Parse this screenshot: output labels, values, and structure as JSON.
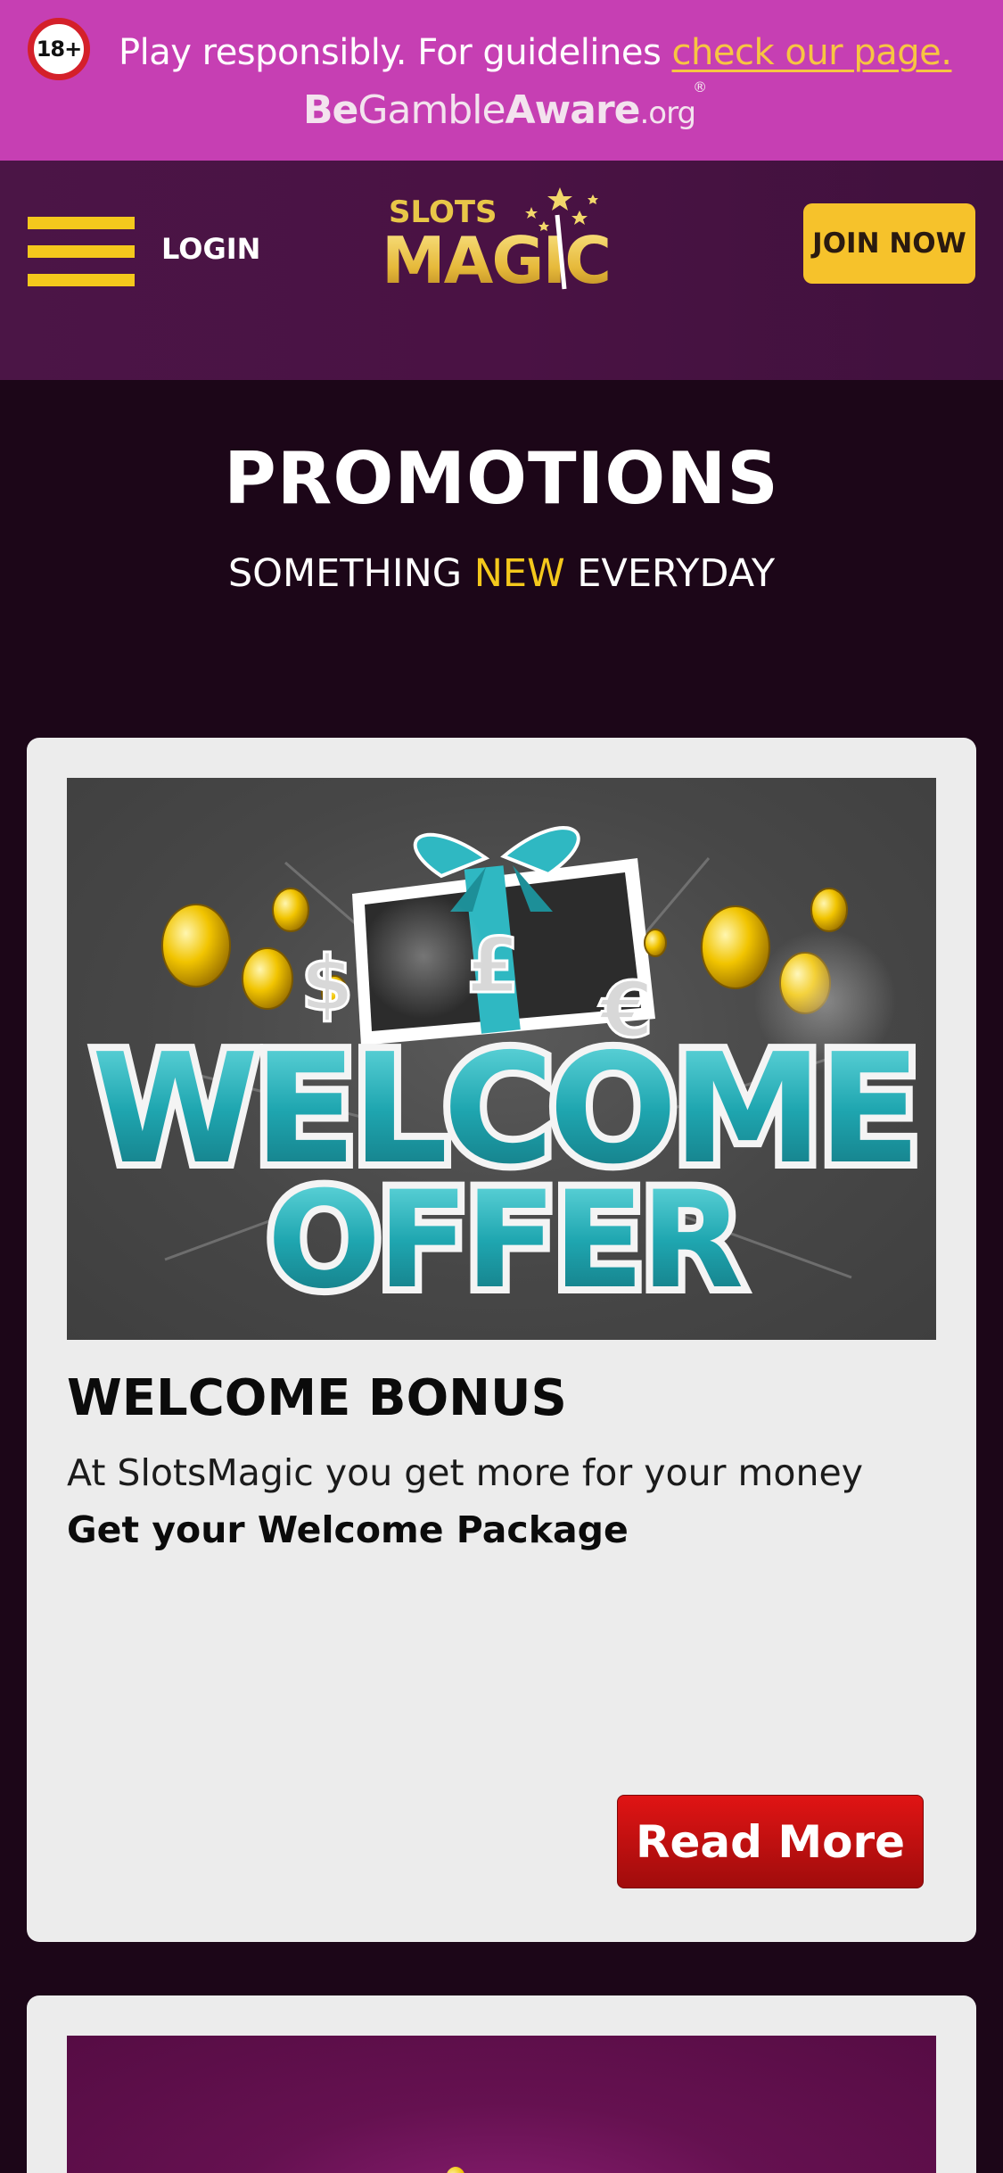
{
  "banner": {
    "age_badge": "18+",
    "text": "Play responsibly. For guidelines ",
    "link_text": "check our page.",
    "logo_be": "Be",
    "logo_gamble": "Gamble",
    "logo_aware": "Aware",
    "logo_org": ".org",
    "logo_reg": "®"
  },
  "header": {
    "menu_icon": "hamburger-menu-icon",
    "login_label": "LOGIN",
    "logo_top": "SLOTS",
    "logo_bottom": "MAGIC",
    "join_label": "JOIN NOW"
  },
  "promotions": {
    "title": "PROMOTIONS",
    "subtitle_before": "SOMETHING ",
    "subtitle_highlight": "NEW",
    "subtitle_after": " EVERYDAY"
  },
  "cards": [
    {
      "image_text_line1": "WELCOME",
      "image_text_line2": "OFFER",
      "currency_symbols": [
        "$",
        "£",
        "€"
      ],
      "title": "WELCOME BONUS",
      "description": "At SlotsMagic you get more for your money",
      "cta_text": "Get your Welcome Package",
      "button_label": "Read More"
    }
  ],
  "colors": {
    "banner_bg": "#c63fb3",
    "header_bg": "#4a1244",
    "page_bg": "#1c0618",
    "accent_yellow": "#f4c81c",
    "card_bg": "#ececec",
    "button_red": "#d01010"
  }
}
